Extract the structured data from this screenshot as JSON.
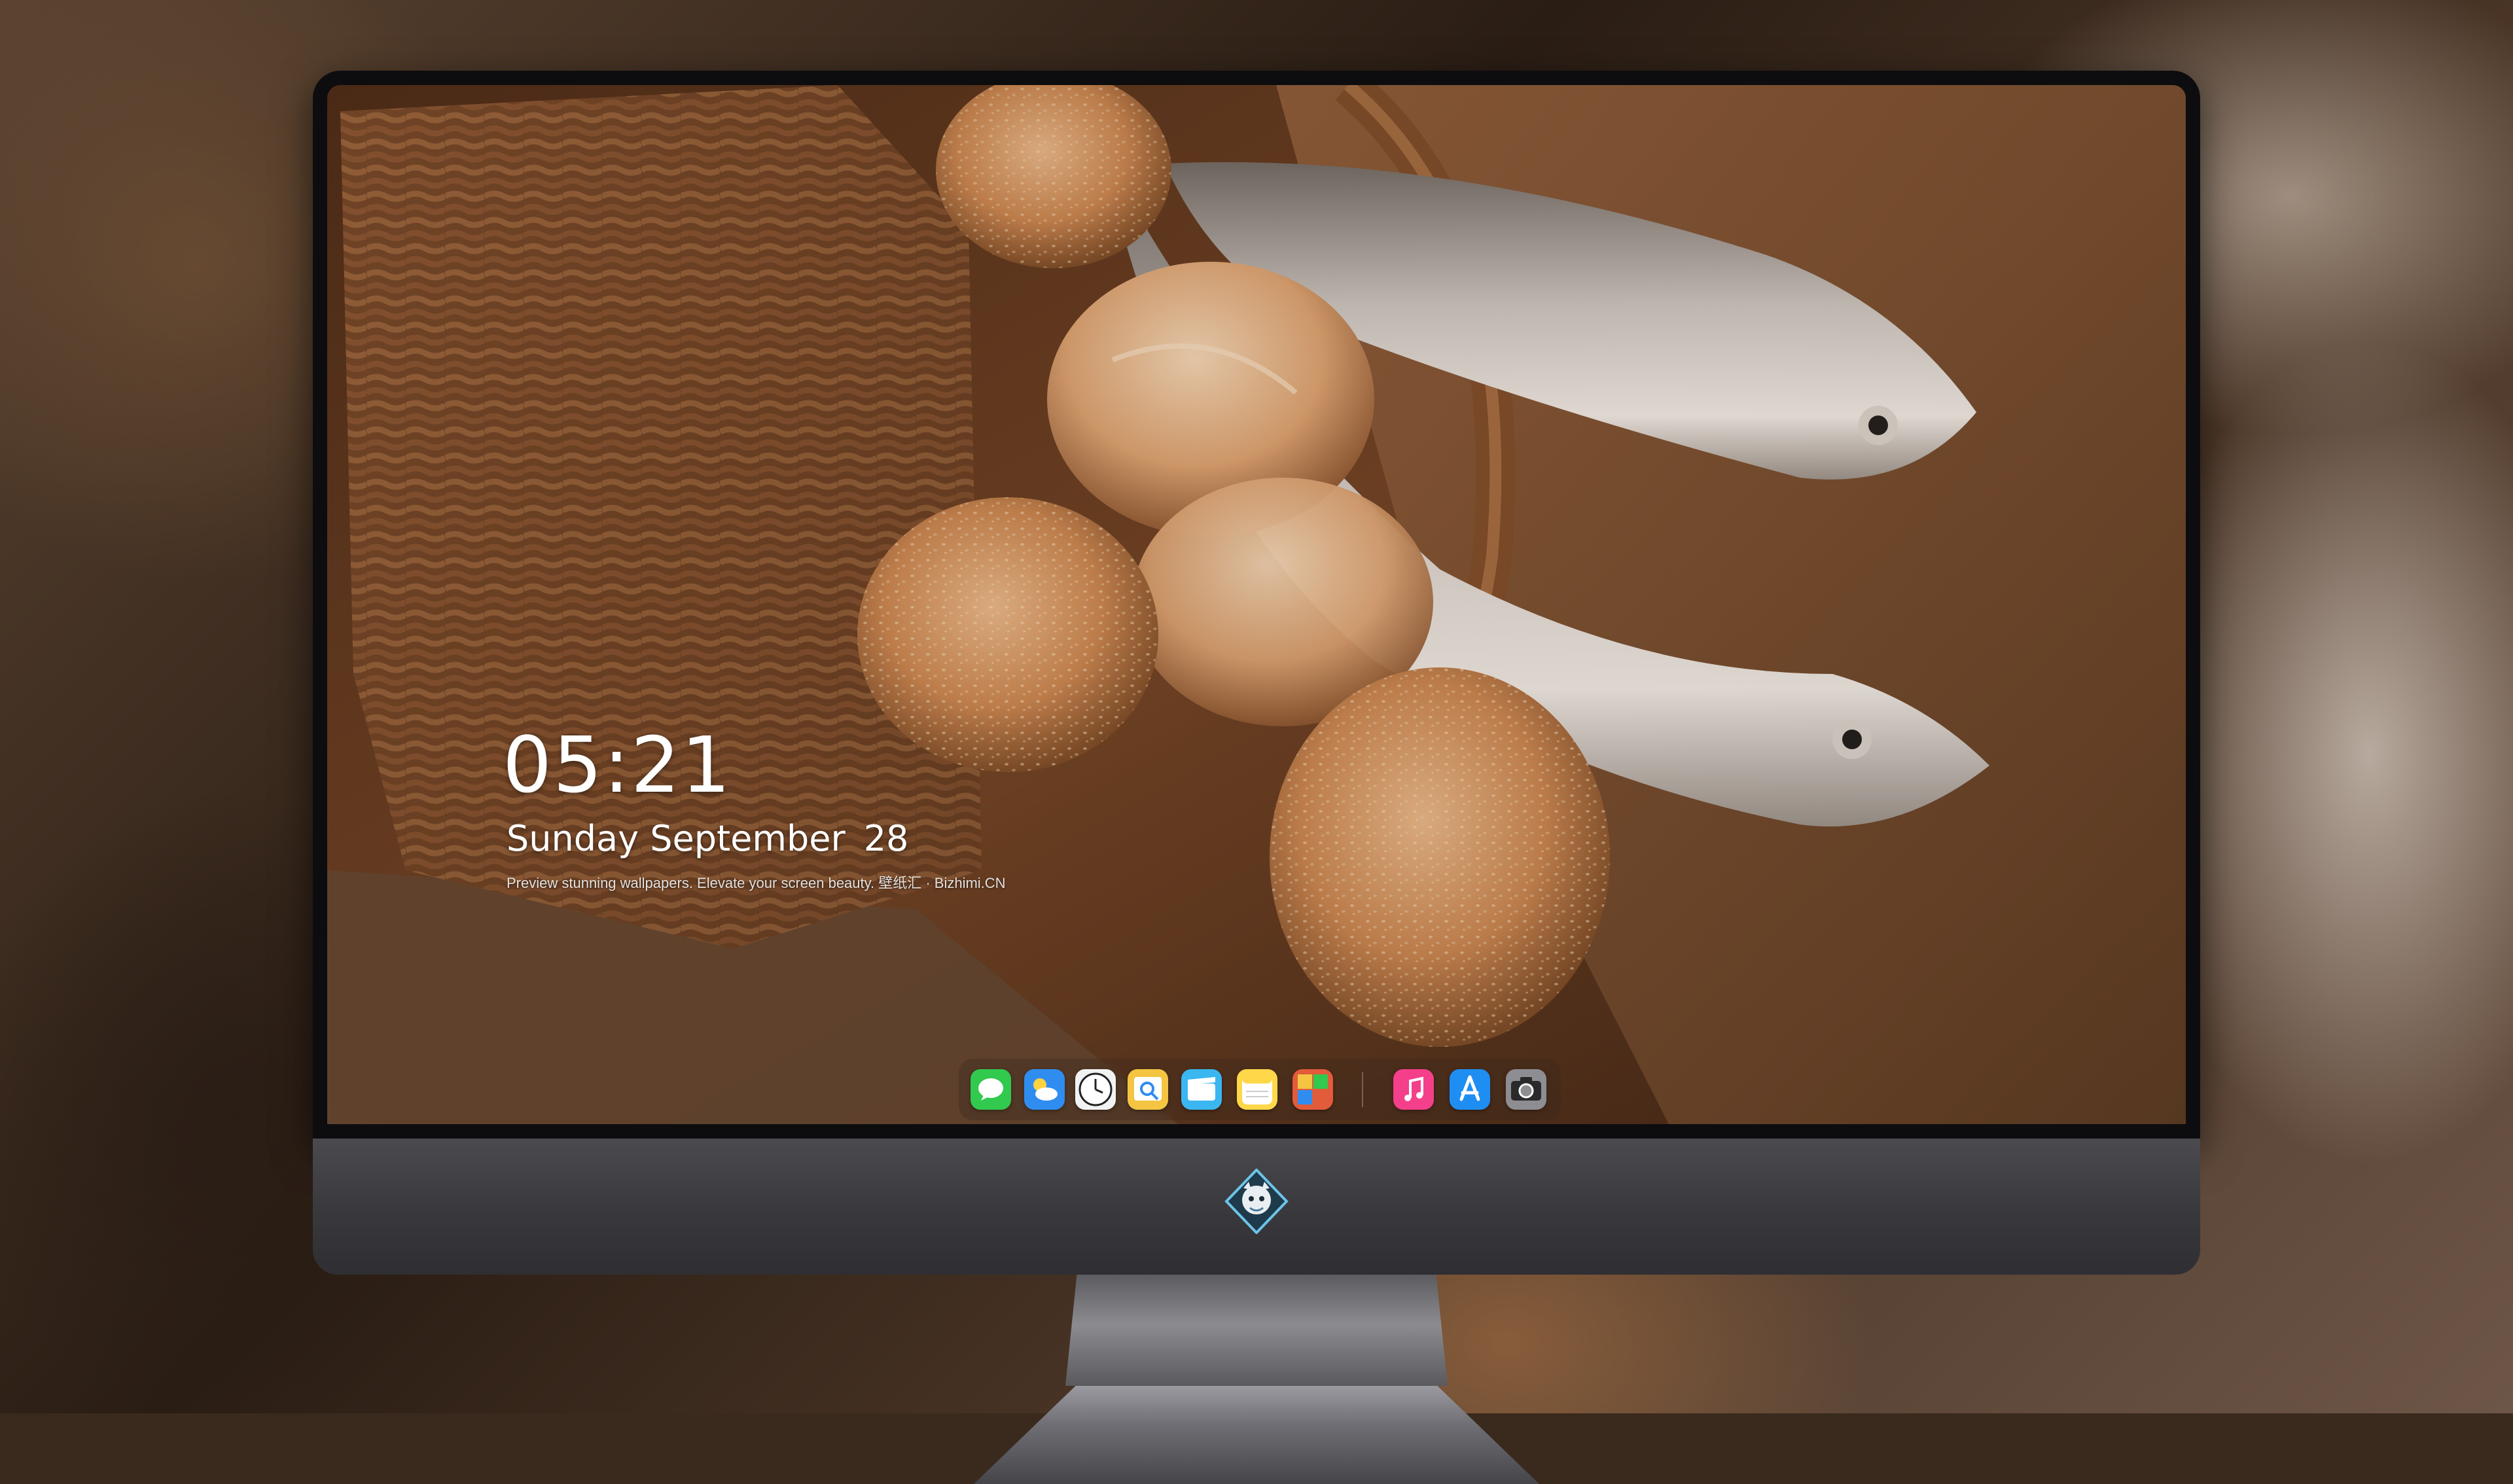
{
  "lockscreen": {
    "time": "05:21",
    "weekday_month": "Sunday September",
    "day": "28",
    "caption": "Preview stunning wallpapers. Elevate your screen beauty. 壁纸汇 · Bizhimi.CN"
  },
  "dock": {
    "apps": [
      {
        "name": "messages-icon",
        "color": "#31c94e"
      },
      {
        "name": "weather-icon",
        "color": "#2f8df0"
      },
      {
        "name": "clock-icon",
        "color": "#f2f2f2"
      },
      {
        "name": "preview-icon",
        "color": "#f4c542"
      },
      {
        "name": "clips-icon",
        "color": "#3ab6f0"
      },
      {
        "name": "notes-icon",
        "color": "#ffd84a"
      },
      {
        "name": "photo-booth-icon",
        "color": "#e25b3a"
      },
      {
        "name": "music-icon",
        "color": "#f43f8a"
      },
      {
        "name": "app-store-icon",
        "color": "#1f8ef3"
      },
      {
        "name": "camera-icon",
        "color": "#8d8d92"
      }
    ]
  },
  "accent_colors": {
    "bezel": "#0d0d0f",
    "chin": "#3a3a3e",
    "wallpaper_tone": "#7a4a2a"
  }
}
